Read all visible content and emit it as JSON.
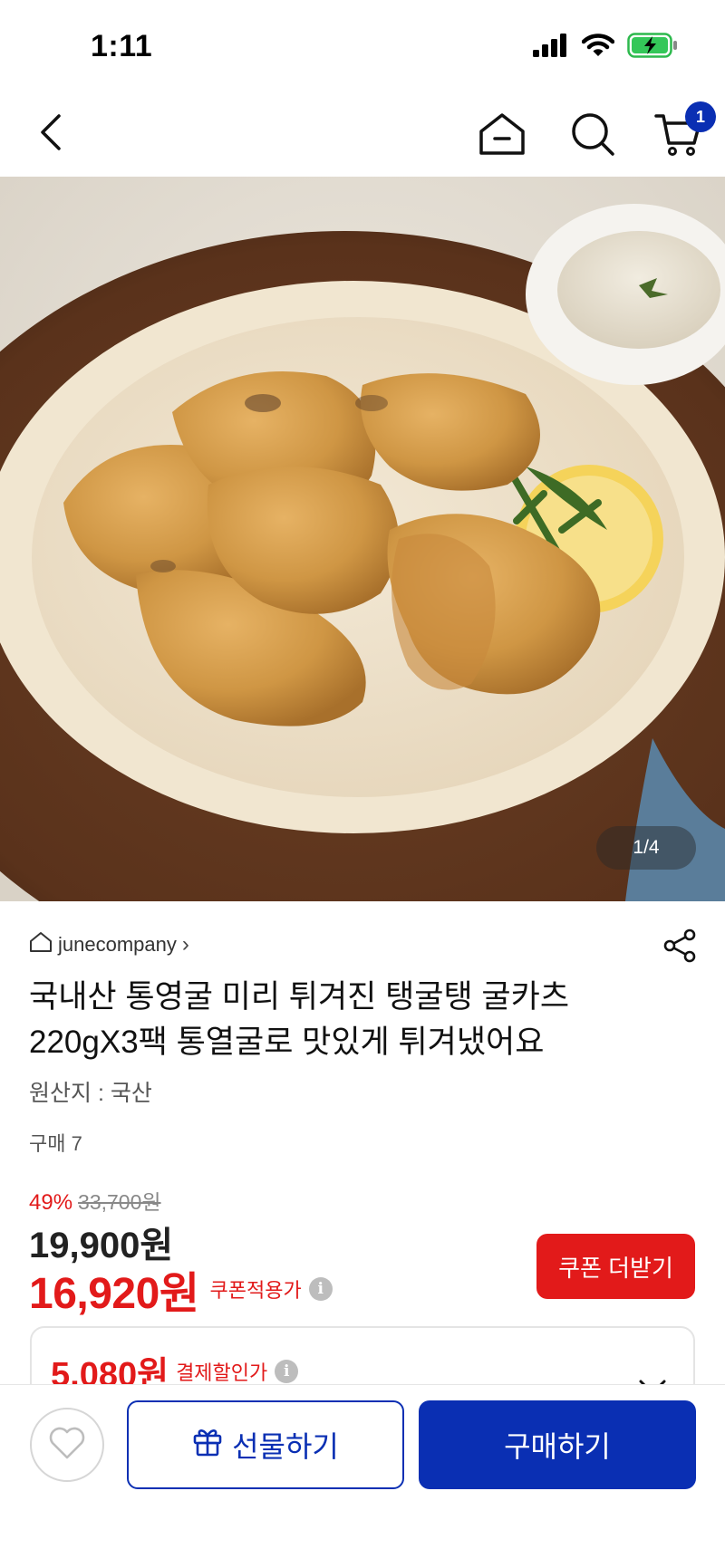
{
  "status_bar": {
    "time": "1:11",
    "icons": [
      "cellular-signal-icon",
      "wifi-icon",
      "battery-charging-icon"
    ]
  },
  "nav": {
    "icons": [
      "back-icon",
      "home-icon",
      "search-icon",
      "cart-icon"
    ],
    "cart_count": "1"
  },
  "product_image": {
    "counter": "1/4"
  },
  "store": {
    "name": "junecompany",
    "icon": "store-home-icon",
    "chevron": "›"
  },
  "product": {
    "title_line1": "국내산 통영굴 미리 튀겨진 탱굴탱 굴카츠",
    "title_line2": "220gX3팩 통열굴로 맛있게 튀겨냈어요",
    "origin": "원산지 : 국산",
    "purchase_count": "구매 7"
  },
  "pricing": {
    "discount_rate": "49%",
    "original_price": "33,700원",
    "sale_price": "19,900원",
    "coupon_price": "16,920원",
    "coupon_label": "쿠폰적용가",
    "coupon_button": "쿠폰 더받기",
    "pay_price": "5,080원",
    "pay_label": "결제할인가",
    "info_glyph": "i"
  },
  "bottom_bar": {
    "gift_label": "선물하기",
    "buy_label": "구매하기"
  },
  "colors": {
    "brand_blue": "#0a2fb3",
    "sale_red": "#e21a1a"
  }
}
